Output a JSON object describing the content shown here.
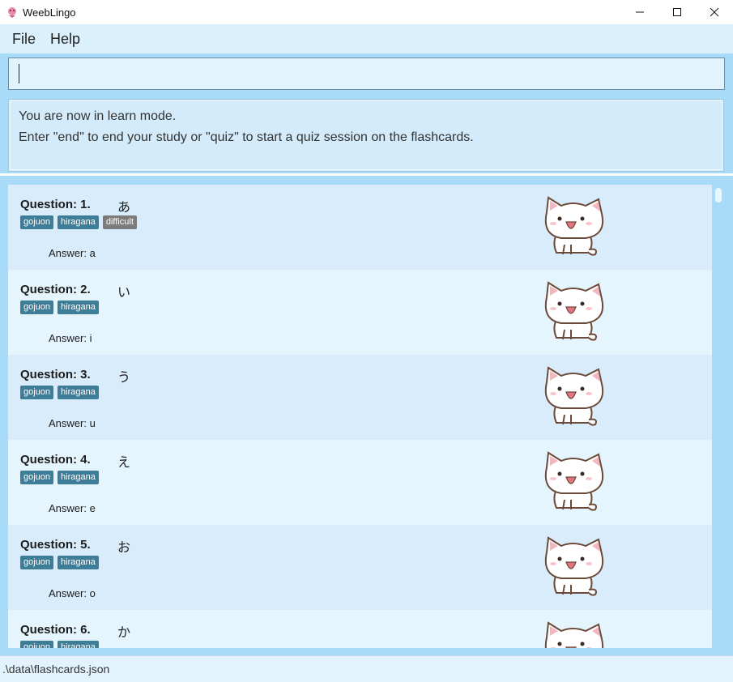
{
  "window": {
    "title": "WeebLingo",
    "minimize": "—",
    "maximize": "☐",
    "close": "✕"
  },
  "menu": {
    "file": "File",
    "help": "Help"
  },
  "command": {
    "value": ""
  },
  "result": {
    "line1": "You are now in learn mode.",
    "line2": "Enter \"end\" to end your study or \"quiz\" to start a quiz session on the flashcards."
  },
  "cards": [
    {
      "label": "Question: 1.",
      "question": "あ",
      "tags": [
        "gojuon",
        "hiragana",
        "difficult"
      ],
      "answer": "Answer: a"
    },
    {
      "label": "Question: 2.",
      "question": "い",
      "tags": [
        "gojuon",
        "hiragana"
      ],
      "answer": "Answer: i"
    },
    {
      "label": "Question: 3.",
      "question": "う",
      "tags": [
        "gojuon",
        "hiragana"
      ],
      "answer": "Answer: u"
    },
    {
      "label": "Question: 4.",
      "question": "え",
      "tags": [
        "gojuon",
        "hiragana"
      ],
      "answer": "Answer: e"
    },
    {
      "label": "Question: 5.",
      "question": "お",
      "tags": [
        "gojuon",
        "hiragana"
      ],
      "answer": "Answer: o"
    },
    {
      "label": "Question: 6.",
      "question": "か",
      "tags": [
        "gojuon",
        "hiragana"
      ],
      "answer": ""
    }
  ],
  "status": {
    "path": ".\\data\\flashcards.json"
  },
  "colors": {
    "tag": "#3d7d98",
    "tag_difficult": "#7c7c7c",
    "accent_band": "#a7dbf7"
  }
}
